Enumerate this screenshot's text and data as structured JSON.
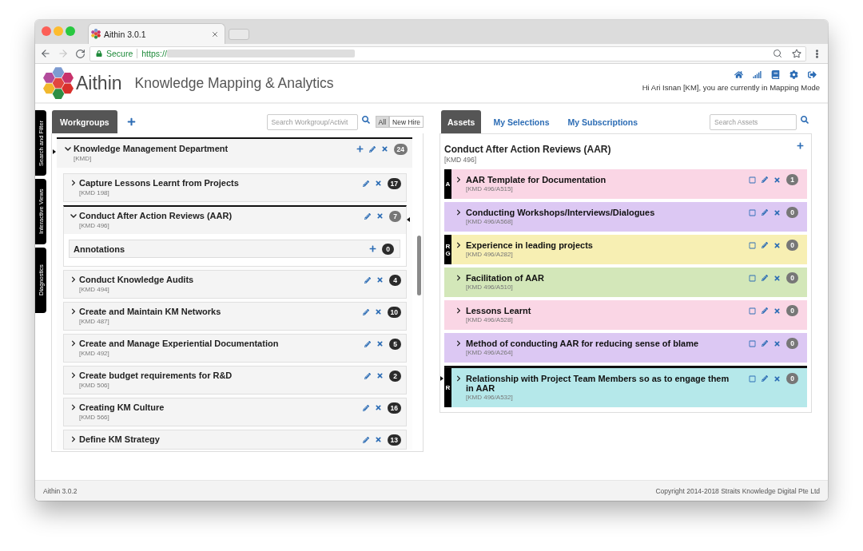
{
  "browser": {
    "tab_title": "Aithin 3.0.1",
    "security": "Secure",
    "url": "https://"
  },
  "header": {
    "brand": "Aithin",
    "title": "Knowledge Mapping & Analytics",
    "greeting": "Hi Ari Isnan [KM], you are currently in Mapping Mode"
  },
  "side_tabs": [
    "Search and Filter",
    "Interactive Views",
    "Diagnostics"
  ],
  "workgroups": {
    "tabs": [
      {
        "label": "Workgroups",
        "selected": true
      }
    ],
    "search_placeholder": "Search Workgroup/Activit",
    "filters": [
      {
        "label": "All",
        "selected": true
      },
      {
        "label": "New Hire",
        "selected": false
      }
    ],
    "tree": [
      {
        "title": "Knowledge Management Department",
        "code": "[KMD]",
        "count": "24",
        "expanded": true,
        "selected": true,
        "children": [
          {
            "title": "Capture Lessons Learnt from Projects",
            "code": "[KMD 198]",
            "count": "17",
            "expanded": false,
            "selected": false
          },
          {
            "title": "Conduct After Action Reviews (AAR)",
            "code": "[KMD 496]",
            "count": "7",
            "expanded": true,
            "selected": true,
            "annotations": {
              "label": "Annotations",
              "count": "0"
            }
          },
          {
            "title": "Conduct Knowledge Audits",
            "code": "[KMD 494]",
            "count": "4",
            "expanded": false,
            "selected": false
          },
          {
            "title": "Create and Maintain KM Networks",
            "code": "[KMD 487]",
            "count": "10",
            "expanded": false,
            "selected": false
          },
          {
            "title": "Create and Manage Experiential Documentation",
            "code": "[KMD 492]",
            "count": "5",
            "expanded": false,
            "selected": false
          },
          {
            "title": "Create budget requirements for R&D",
            "code": "[KMD 506]",
            "count": "2",
            "expanded": false,
            "selected": false
          },
          {
            "title": "Creating KM Culture",
            "code": "[KMD 566]",
            "count": "16",
            "expanded": false,
            "selected": false
          },
          {
            "title": "Define KM Strategy",
            "count": "13",
            "expanded": false,
            "selected": false
          }
        ]
      }
    ]
  },
  "assets": {
    "tabs": [
      {
        "label": "Assets",
        "selected": true
      },
      {
        "label": "My Selections",
        "selected": false
      },
      {
        "label": "My Subscriptions",
        "selected": false
      }
    ],
    "search_placeholder": "Search Assets",
    "title": "Conduct After Action Reviews (AAR)",
    "code": "[KMD 496]",
    "items": [
      {
        "title": "AAR Template for Documentation",
        "code": "[KMD 496/A515]",
        "count": "1",
        "color": "#fad6e5",
        "markers": [
          "A"
        ],
        "expanded": false,
        "selected": false
      },
      {
        "title": "Conducting Workshops/Interviews/Dialogues",
        "code": "[KMD 496/A568]",
        "count": "0",
        "color": "#dcc8f3",
        "expanded": false,
        "selected": false
      },
      {
        "title": "Experience in leading projects",
        "code": "[KMD 496/A282]",
        "count": "0",
        "color": "#f7efb3",
        "markers": [
          "R",
          "G"
        ],
        "expanded": false,
        "selected": false
      },
      {
        "title": "Facilitation of AAR",
        "code": "[KMD 496/A510]",
        "count": "0",
        "color": "#d3e7b9",
        "expanded": false,
        "selected": false
      },
      {
        "title": "Lessons Learnt",
        "code": "[KMD 496/A528]",
        "count": "0",
        "color": "#fad6e5",
        "expanded": false,
        "selected": false
      },
      {
        "title": "Method of conducting AAR for reducing sense of blame",
        "code": "[KMD 496/A264]",
        "count": "0",
        "color": "#dcc8f3",
        "expanded": false,
        "selected": false
      },
      {
        "title": "Relationship with Project Team Members so as to engage them in AAR",
        "code": "[KMD 496/A532]",
        "count": "0",
        "color": "#b5e8ea",
        "markers": [
          "R"
        ],
        "expanded": false,
        "selected": true
      }
    ]
  },
  "footer": {
    "version": "Aithin 3.0.2",
    "copyright": "Copyright 2014-2018 Straits Knowledge Digital Pte Ltd"
  }
}
